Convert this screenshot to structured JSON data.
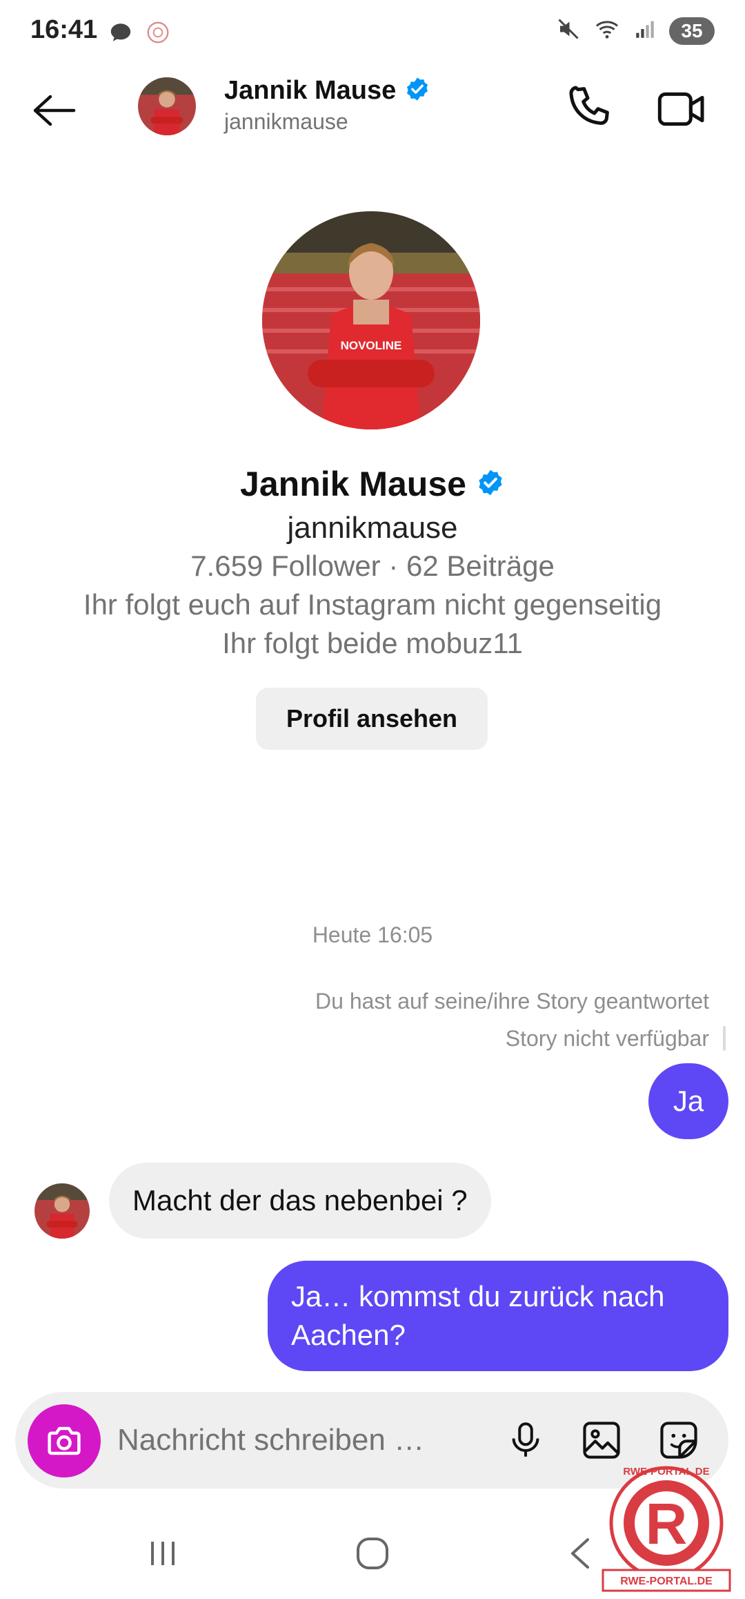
{
  "status_bar": {
    "time": "16:41",
    "battery": "35",
    "icons": [
      "chat-bubble-icon",
      "app-notification-icon",
      "mute-icon",
      "wifi-icon",
      "signal-icon",
      "battery-icon"
    ]
  },
  "header": {
    "name": "Jannik Mause",
    "username": "jannikmause",
    "verified": true,
    "icons": [
      "back-arrow-icon",
      "phone-icon",
      "video-camera-icon"
    ]
  },
  "profile": {
    "name": "Jannik Mause",
    "username": "jannikmause",
    "stats": "7.659 Follower · 62 Beiträge",
    "mutual_line_1": "Ihr folgt euch auf Instagram nicht gegenseitig",
    "mutual_line_2": "Ihr folgt beide mobuz11",
    "view_profile_label": "Profil ansehen",
    "jersey_text": "NOVOLINE"
  },
  "chat": {
    "timestamp": "Heute 16:05",
    "story_reply_note": "Du hast auf seine/ihre Story geantwortet",
    "story_unavailable": "Story nicht verfügbar",
    "messages": [
      {
        "from": "me",
        "text": "Ja"
      },
      {
        "from": "them",
        "text": "Macht der das nebenbei ?"
      },
      {
        "from": "me",
        "text": "Ja… kommst du zurück nach Aachen?"
      }
    ]
  },
  "composer": {
    "placeholder": "Nachricht schreiben …",
    "icons": [
      "camera-icon",
      "microphone-icon",
      "gallery-icon",
      "sticker-icon"
    ]
  },
  "watermark": {
    "top_text": "RWE-PORTAL.DE",
    "bottom_text": "RWE-PORTAL.DE",
    "letter": "R"
  },
  "colors": {
    "sent_bubble": "#5e48f5",
    "received_bubble": "#efefef",
    "camera_button": "#d418c8",
    "verified_badge": "#0095f6",
    "jersey_red": "#d7282f"
  }
}
